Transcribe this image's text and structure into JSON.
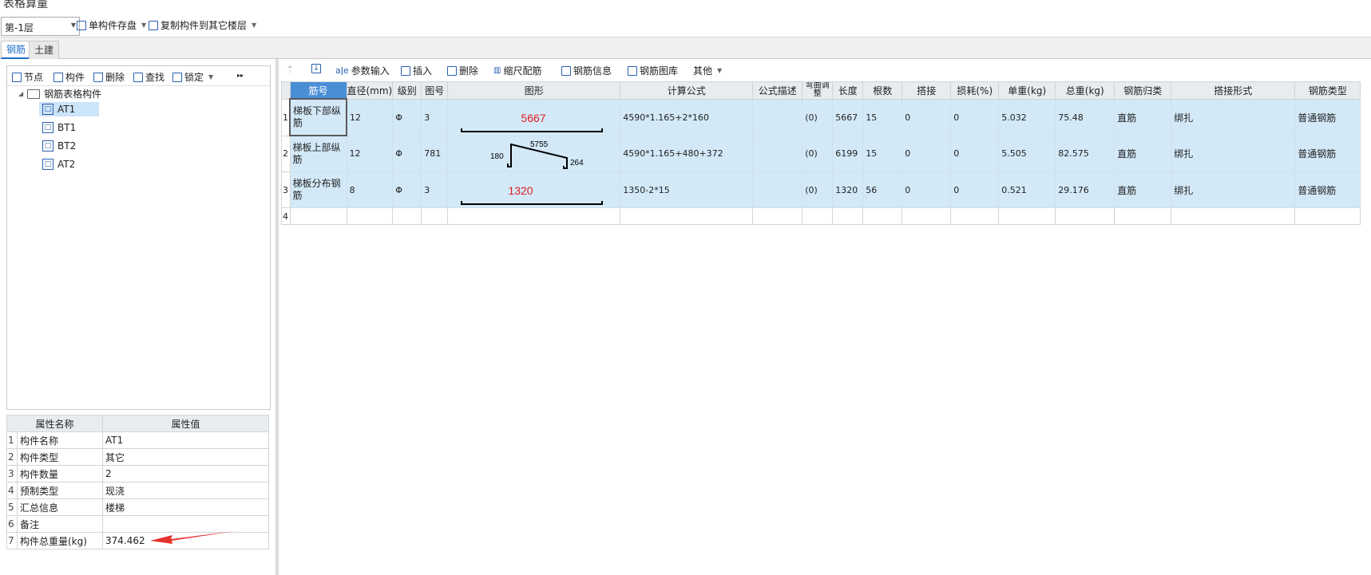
{
  "window": {
    "title": "表格算量"
  },
  "topbar": {
    "floor_select": "第-1层",
    "save_component": "单构件存盘",
    "copy_component": "复制构件到其它楼层"
  },
  "tabs": [
    "钢筋",
    "土建"
  ],
  "left_toolbar": {
    "node": "节点",
    "component": "构件",
    "delete": "删除",
    "find": "查找",
    "lock": "锁定",
    "more": "▸▸"
  },
  "tree": {
    "root": "钢筋表格构件",
    "items": [
      "AT1",
      "BT1",
      "BT2",
      "AT2"
    ],
    "selected": "AT1"
  },
  "properties": {
    "headers": [
      "属性名称",
      "属性值"
    ],
    "rows": [
      {
        "no": "1",
        "name": "构件名称",
        "value": "AT1"
      },
      {
        "no": "2",
        "name": "构件类型",
        "value": "其它"
      },
      {
        "no": "3",
        "name": "构件数量",
        "value": "2"
      },
      {
        "no": "4",
        "name": "预制类型",
        "value": "现浇"
      },
      {
        "no": "5",
        "name": "汇总信息",
        "value": "楼梯"
      },
      {
        "no": "6",
        "name": "备注",
        "value": ""
      },
      {
        "no": "7",
        "name": "构件总重量(kg)",
        "value": "374.462"
      }
    ]
  },
  "right_toolbar": {
    "param_input": "参数输入",
    "insert": "插入",
    "delete": "删除",
    "scale_rebar": "缩尺配筋",
    "rebar_info": "钢筋信息",
    "rebar_library": "钢筋图库",
    "other": "其他"
  },
  "grid": {
    "headers": [
      "筋号",
      "直径(mm)",
      "级别",
      "图号",
      "图形",
      "计算公式",
      "公式描述",
      "弯曲调整",
      "长度",
      "根数",
      "搭接",
      "损耗(%)",
      "单重(kg)",
      "总重(kg)",
      "钢筋归类",
      "搭接形式",
      "钢筋类型"
    ],
    "rows": [
      {
        "no": "1",
        "name": "梯板下部纵筋",
        "dia": "12",
        "grade": "Φ",
        "fig": "3",
        "shape_label": "5667",
        "formula": "4590*1.165+2*160",
        "desc": "",
        "bend": "(0)",
        "len": "5667",
        "count": "15",
        "lap": "0",
        "loss": "0",
        "unit_w": "5.032",
        "total_w": "75.48",
        "category": "直筋",
        "lap_type": "绑扎",
        "rebar_type": "普通钢筋"
      },
      {
        "no": "2",
        "name": "梯板上部纵筋",
        "dia": "12",
        "grade": "Φ",
        "fig": "781",
        "shape_left": "180",
        "shape_top": "5755",
        "shape_right": "264",
        "formula": "4590*1.165+480+372",
        "desc": "",
        "bend": "(0)",
        "len": "6199",
        "count": "15",
        "lap": "0",
        "loss": "0",
        "unit_w": "5.505",
        "total_w": "82.575",
        "category": "直筋",
        "lap_type": "绑扎",
        "rebar_type": "普通钢筋"
      },
      {
        "no": "3",
        "name": "梯板分布钢筋",
        "dia": "8",
        "grade": "Φ",
        "fig": "3",
        "shape_label": "1320",
        "formula": "1350-2*15",
        "desc": "",
        "bend": "(0)",
        "len": "1320",
        "count": "56",
        "lap": "0",
        "loss": "0",
        "unit_w": "0.521",
        "total_w": "29.176",
        "category": "直筋",
        "lap_type": "绑扎",
        "rebar_type": "普通钢筋"
      }
    ],
    "empty_row_no": "4"
  },
  "colors": {
    "accent": "#1f6fc5",
    "row_bg": "#d3e9f8",
    "shape_label": "#e02020",
    "arrow": "#e8322f"
  }
}
